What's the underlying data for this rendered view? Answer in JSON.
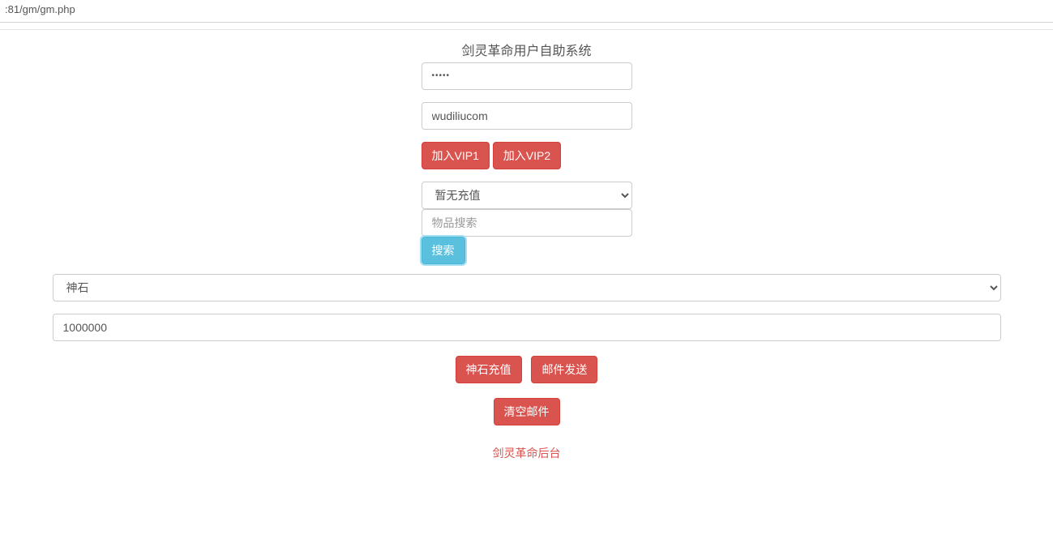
{
  "address_bar": ":81/gm/gm.php",
  "title": "剑灵革命用户自助系统",
  "password_field": {
    "masked_value": "•••••"
  },
  "username_field": {
    "value": "wudiliucom"
  },
  "vip_buttons": {
    "vip1": "加入VIP1",
    "vip2": "加入VIP2"
  },
  "recharge_select": {
    "selected": "暂无充值"
  },
  "item_search": {
    "placeholder": "物品搜索"
  },
  "search_button": "搜索",
  "item_select": {
    "selected": "神石"
  },
  "amount_input": {
    "value": "1000000"
  },
  "action_buttons": {
    "shenshi_recharge": "神石充值",
    "mail_send": "邮件发送",
    "clear_mail": "清空邮件"
  },
  "footer_link": "剑灵革命后台"
}
